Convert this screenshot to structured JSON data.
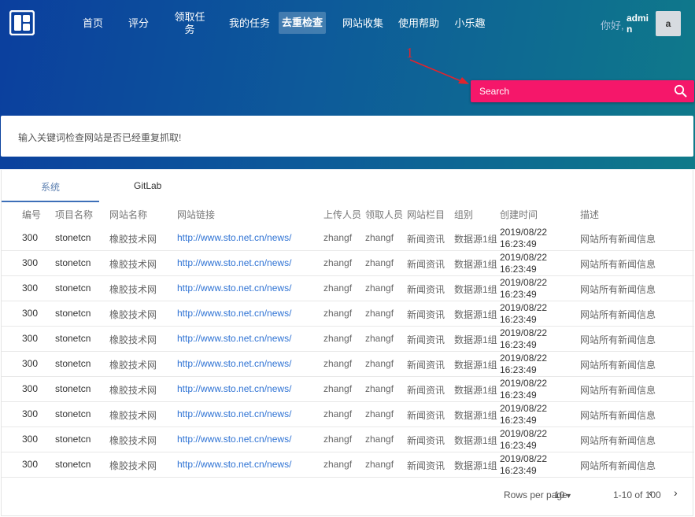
{
  "nav": {
    "items": [
      {
        "label": "首页",
        "active": false
      },
      {
        "label": "评分",
        "active": false
      },
      {
        "label": "领取任务",
        "active": false
      },
      {
        "label": "我的任务",
        "active": false
      },
      {
        "label": "去重检查",
        "active": true
      },
      {
        "label": "网站收集",
        "active": false
      },
      {
        "label": "使用帮助",
        "active": false
      },
      {
        "label": "小乐趣",
        "active": false
      }
    ],
    "greeting": "你好,",
    "username": "admin",
    "avatar_letter": "a"
  },
  "annotation": {
    "number": "1"
  },
  "search": {
    "placeholder": "Search",
    "icon": "search-icon"
  },
  "info": {
    "text": "输入关键词检查网站是否已经重复抓取!"
  },
  "tabs": [
    {
      "label": "系统",
      "active": true
    },
    {
      "label": "GitLab",
      "active": false
    }
  ],
  "table": {
    "headers": [
      "编号",
      "项目名称",
      "网站名称",
      "网站链接",
      "上传人员",
      "领取人员",
      "网站栏目",
      "组别",
      "创建时间",
      "描述"
    ],
    "rows": [
      [
        "300",
        "stonetcn",
        "橡胶技术网",
        "http://www.sto.net.cn/news/",
        "zhangf",
        "zhangf",
        "新闻资讯",
        "数据源1组",
        "2019/08/22 16:23:49",
        "网站所有新闻信息"
      ],
      [
        "300",
        "stonetcn",
        "橡胶技术网",
        "http://www.sto.net.cn/news/",
        "zhangf",
        "zhangf",
        "新闻资讯",
        "数据源1组",
        "2019/08/22 16:23:49",
        "网站所有新闻信息"
      ],
      [
        "300",
        "stonetcn",
        "橡胶技术网",
        "http://www.sto.net.cn/news/",
        "zhangf",
        "zhangf",
        "新闻资讯",
        "数据源1组",
        "2019/08/22 16:23:49",
        "网站所有新闻信息"
      ],
      [
        "300",
        "stonetcn",
        "橡胶技术网",
        "http://www.sto.net.cn/news/",
        "zhangf",
        "zhangf",
        "新闻资讯",
        "数据源1组",
        "2019/08/22 16:23:49",
        "网站所有新闻信息"
      ],
      [
        "300",
        "stonetcn",
        "橡胶技术网",
        "http://www.sto.net.cn/news/",
        "zhangf",
        "zhangf",
        "新闻资讯",
        "数据源1组",
        "2019/08/22 16:23:49",
        "网站所有新闻信息"
      ],
      [
        "300",
        "stonetcn",
        "橡胶技术网",
        "http://www.sto.net.cn/news/",
        "zhangf",
        "zhangf",
        "新闻资讯",
        "数据源1组",
        "2019/08/22 16:23:49",
        "网站所有新闻信息"
      ],
      [
        "300",
        "stonetcn",
        "橡胶技术网",
        "http://www.sto.net.cn/news/",
        "zhangf",
        "zhangf",
        "新闻资讯",
        "数据源1组",
        "2019/08/22 16:23:49",
        "网站所有新闻信息"
      ],
      [
        "300",
        "stonetcn",
        "橡胶技术网",
        "http://www.sto.net.cn/news/",
        "zhangf",
        "zhangf",
        "新闻资讯",
        "数据源1组",
        "2019/08/22 16:23:49",
        "网站所有新闻信息"
      ],
      [
        "300",
        "stonetcn",
        "橡胶技术网",
        "http://www.sto.net.cn/news/",
        "zhangf",
        "zhangf",
        "新闻资讯",
        "数据源1组",
        "2019/08/22 16:23:49",
        "网站所有新闻信息"
      ],
      [
        "300",
        "stonetcn",
        "橡胶技术网",
        "http://www.sto.net.cn/news/",
        "zhangf",
        "zhangf",
        "新闻资讯",
        "数据源1组",
        "2019/08/22 16:23:49",
        "网站所有新闻信息"
      ]
    ]
  },
  "pagination": {
    "rows_per_page_label": "Rows per page",
    "rows_per_page_value": "10",
    "range": "1-10 of 100"
  },
  "colors": {
    "search_bg": "#f5176a",
    "link": "#2f73d4",
    "annotation": "#e0242e",
    "tab_active": "#3d6fb8"
  }
}
